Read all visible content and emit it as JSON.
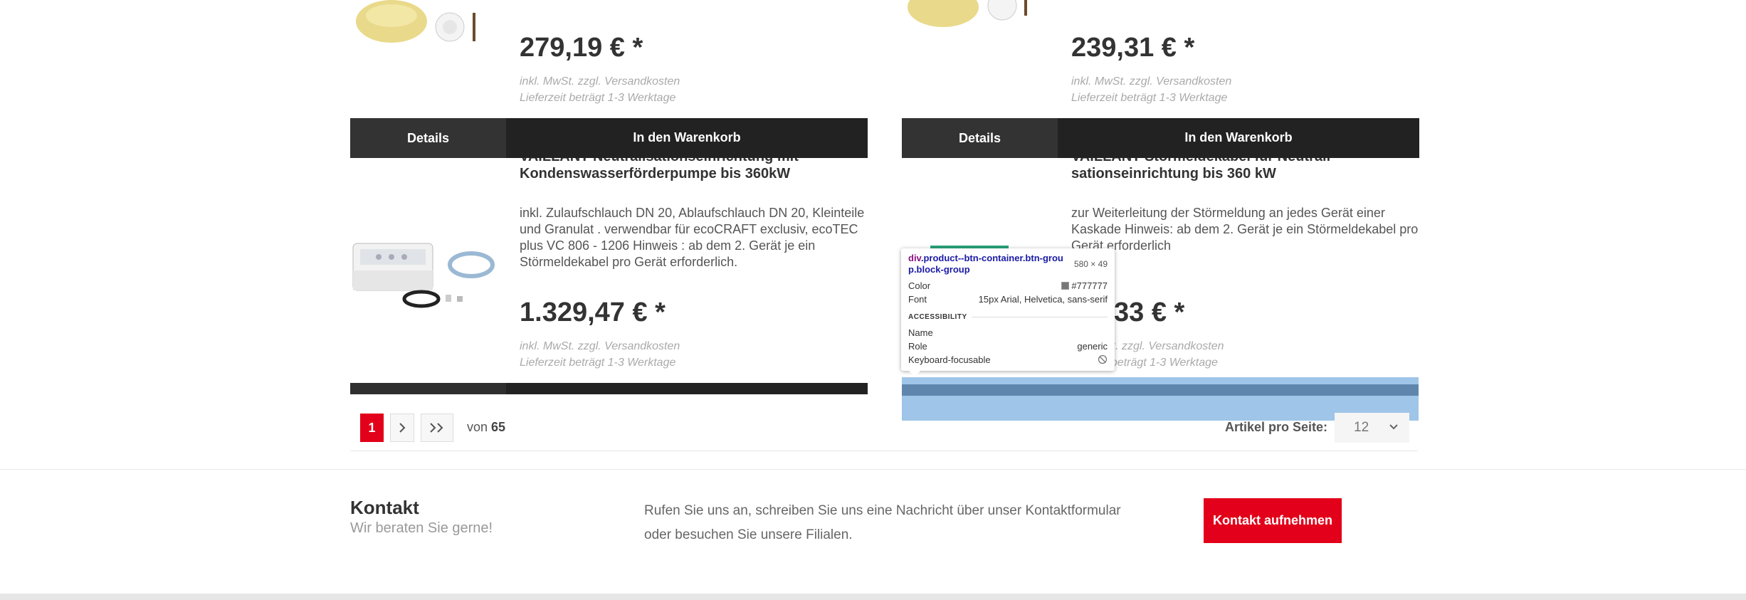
{
  "products": [
    {
      "price": "279,19 € *",
      "tax_note": "inkl. MwSt. zzgl. Versandkosten",
      "delivery_note": "Lieferzeit beträgt 1-3 Werktage",
      "details_label": "Details",
      "cart_label": "In den Warenkorb"
    },
    {
      "price": "239,31 € *",
      "tax_note": "inkl. MwSt. zzgl. Versandkosten",
      "delivery_note": "Lieferzeit beträgt 1-3 Werktage",
      "details_label": "Details",
      "cart_label": "In den Warenkorb"
    },
    {
      "title_line1": "VAILLANT Neutralisationseinrichtung mit",
      "title_line2": "Kondenswasserförderpumpe bis 360kW",
      "description": "inkl. Zulaufschlauch DN 20, Ablaufschlauch DN 20, Kleinteile und Granulat . verwendbar für ecoCRAFT exclusiv, ecoTEC plus VC 806 - 1206 Hinweis : ab dem 2. Gerät je ein Störmeldekabel pro Gerät erforderlich.",
      "price": "1.329,47 € *",
      "tax_note": "inkl. MwSt. zzgl. Versandkosten",
      "delivery_note": "Lieferzeit beträgt 1-3 Werktage"
    },
    {
      "title_line1": "VAILLANT Störmeldekabel für Neutrali-",
      "title_line2": "sationseinrichtung bis 360 kW",
      "description": "zur Weiterleitung der Störmeldung an jedes Gerät einer Kaskade Hinweis: ab dem 2. Gerät je ein Störmeldekabel pro Gerät erforderlich",
      "price_visible": "33 € *",
      "tax_note_visible": "St. zzgl. Versandkosten",
      "delivery_note_visible": "t beträgt 1-3 Werktage"
    }
  ],
  "pagination": {
    "current_page": "1",
    "next_icon": "chevron-right-icon",
    "last_icon": "double-chevron-right-icon",
    "of_label": "von",
    "total_pages": "65",
    "per_page_label": "Artikel pro Seite:",
    "per_page_value": "12"
  },
  "contact": {
    "heading": "Kontakt",
    "subheading": "Wir beraten Sie gerne!",
    "text": "Rufen Sie uns an, schreiben Sie uns eine Nachricht über unser Kontaktformular oder besuchen Sie unsere Filialen.",
    "button_label": "Kontakt aufnehmen"
  },
  "devtools_tooltip": {
    "selector_tag": "div",
    "selector_classes_line1": ".product--btn-container.btn-grou",
    "selector_classes_line2": "p.block-group",
    "dimensions": "580 × 49",
    "color_label": "Color",
    "color_value": "#777777",
    "font_label": "Font",
    "font_value": "15px Arial, Helvetica, sans-serif",
    "accessibility_heading": "ACCESSIBILITY",
    "name_label": "Name",
    "name_value": "",
    "role_label": "Role",
    "role_value": "generic",
    "keyboard_label": "Keyboard-focusable",
    "keyboard_icon": "not-allowed-icon"
  },
  "colors": {
    "accent_red": "#e2001a",
    "button_dark": "#222222",
    "highlight_blue": "#9fc5e8",
    "selector_purple": "#881280",
    "selector_blue": "#1a1aa6"
  }
}
